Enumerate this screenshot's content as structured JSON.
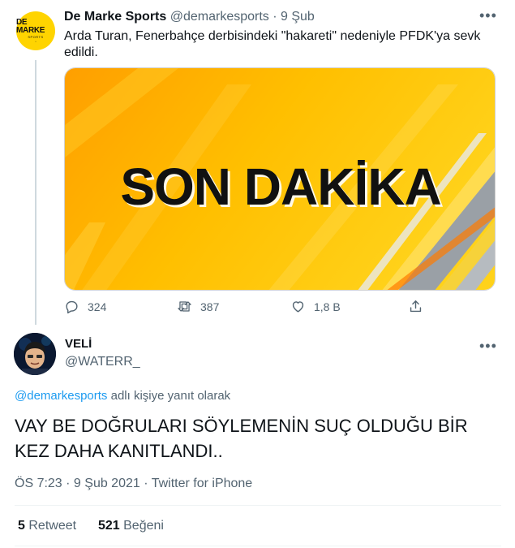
{
  "parent": {
    "avatar": {
      "line1": "DE MARKE",
      "line2": "SPORTS",
      "line3": "•",
      "bg": "#ffd400"
    },
    "name": "De Marke Sports",
    "handle": "@demarkesports",
    "separator": "·",
    "date": "9 Şub",
    "more": "•••",
    "text": "Arda Turan, Fenerbahçe derbisindeki \"hakareti\" nedeniyle PFDK'ya sevk edildi.",
    "media": {
      "headline": "SON DAKİKA",
      "bg": "#ffb400"
    },
    "actions": {
      "reply": {
        "icon": "reply-icon",
        "count": "324"
      },
      "retweet": {
        "icon": "retweet-icon",
        "count": "387"
      },
      "like": {
        "icon": "heart-icon",
        "count": "1,8 B"
      },
      "share": {
        "icon": "share-icon"
      }
    }
  },
  "reply": {
    "name": "VELİ",
    "handle": "@WATERR_",
    "more": "•••",
    "replying_mention": "@demarkesports",
    "replying_suffix": "adlı kişiye yanıt olarak",
    "text": "VAY BE DOĞRULARI SÖYLEMENİN SUÇ OLDUĞU BİR KEZ DAHA KANITLANDI..",
    "meta": "ÖS 7:23 · 9 Şub 2021 · Twitter for iPhone",
    "stats": {
      "retweets_count": "5",
      "retweets_label": "Retweet",
      "likes_count": "521",
      "likes_label": "Beğeni"
    }
  },
  "colors": {
    "accent": "#1d9bf0",
    "secondary_text": "#536471",
    "primary_text": "#0f1419"
  }
}
